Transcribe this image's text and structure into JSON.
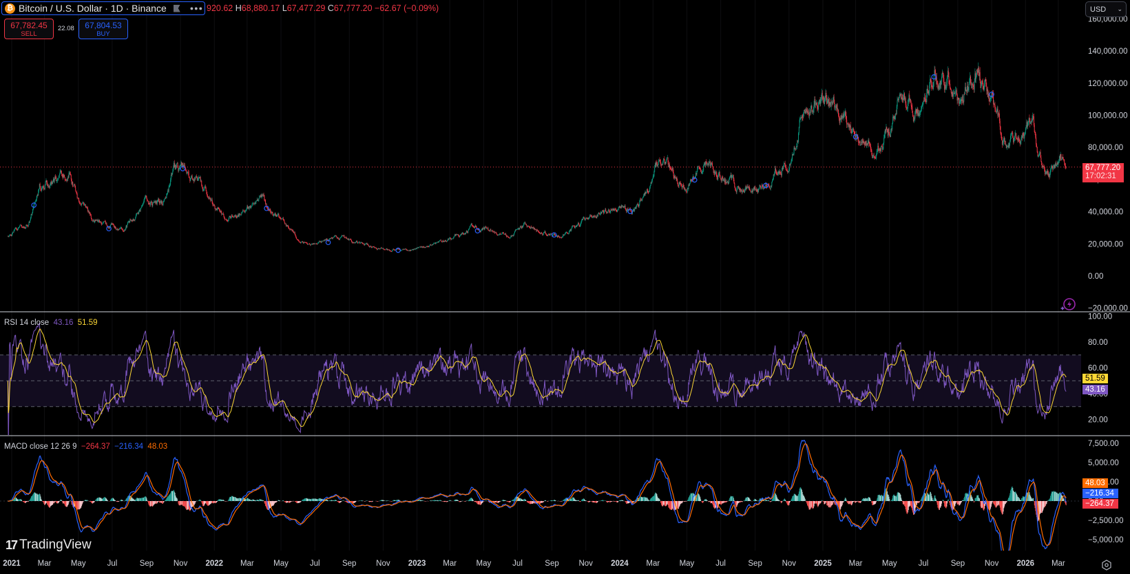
{
  "header": {
    "symbol_title": "Bitcoin / U.S. Dollar · 1D · Binance",
    "icon": "bitcoin-icon",
    "ohlc": {
      "open_partial": "920.62",
      "h_label": "H",
      "high": "68,880.17",
      "l_label": "L",
      "low": "67,477.29",
      "c_label": "C",
      "close": "67,777.20",
      "change": "−62.67 (−0.09%)"
    },
    "sell": {
      "price": "67,782.45",
      "label": "SELL"
    },
    "spread": "22.08",
    "buy": {
      "price": "67,804.53",
      "label": "BUY"
    },
    "currency": "USD"
  },
  "price_label": {
    "price": "67,777.20",
    "countdown": "17:02:31"
  },
  "rsi": {
    "title": "RSI 14 close",
    "rsi_value": "43.16",
    "ma_value": "51.59"
  },
  "macd": {
    "title": "MACD close 12 26 9",
    "hist_value": "−264.37",
    "macd_value": "−216.34",
    "signal_value": "48.03"
  },
  "logo": "TradingView",
  "colors": {
    "up": "#089981",
    "down": "#f23645",
    "rsi": "#7e57c2",
    "rsi_ma": "#fdd835",
    "macd": "#2962ff",
    "signal": "#ff6d00",
    "hist_up": "#26a69a",
    "hist_down": "#ff5252",
    "accent": "#2962ff"
  },
  "chart_data": [
    {
      "type": "candlestick",
      "title": "Bitcoin / U.S. Dollar · 1D · Binance",
      "ylim": [
        -20000,
        165000
      ],
      "y_ticks": [
        {
          "label": "160,000.00",
          "value": 160000
        },
        {
          "label": "140,000.00",
          "value": 140000
        },
        {
          "label": "120,000.00",
          "value": 120000
        },
        {
          "label": "100,000.00",
          "value": 100000
        },
        {
          "label": "80,000.00",
          "value": 80000
        },
        {
          "label": "60,000.00",
          "value": 60000
        },
        {
          "label": "40,000.00",
          "value": 40000
        },
        {
          "label": "20,000.00",
          "value": 20000
        },
        {
          "label": "0.00",
          "value": 0
        },
        {
          "label": "−20,000.00",
          "value": -20000
        }
      ],
      "x_ticks": [
        {
          "label": "2021",
          "date": "2021-01-01",
          "bold": true
        },
        {
          "label": "Mar",
          "date": "2021-03-01"
        },
        {
          "label": "May",
          "date": "2021-05-01"
        },
        {
          "label": "Jul",
          "date": "2021-07-01"
        },
        {
          "label": "Sep",
          "date": "2021-09-01"
        },
        {
          "label": "Nov",
          "date": "2021-11-01"
        },
        {
          "label": "2022",
          "date": "2022-01-01",
          "bold": true
        },
        {
          "label": "Mar",
          "date": "2022-03-01"
        },
        {
          "label": "May",
          "date": "2022-05-01"
        },
        {
          "label": "Jul",
          "date": "2022-07-01"
        },
        {
          "label": "Sep",
          "date": "2022-09-01"
        },
        {
          "label": "Nov",
          "date": "2022-11-01"
        },
        {
          "label": "2023",
          "date": "2023-01-01",
          "bold": true
        },
        {
          "label": "Mar",
          "date": "2023-03-01"
        },
        {
          "label": "May",
          "date": "2023-05-01"
        },
        {
          "label": "Jul",
          "date": "2023-07-01"
        },
        {
          "label": "Sep",
          "date": "2023-09-01"
        },
        {
          "label": "Nov",
          "date": "2023-11-01"
        },
        {
          "label": "2024",
          "date": "2024-01-01",
          "bold": true
        },
        {
          "label": "Mar",
          "date": "2024-03-01"
        },
        {
          "label": "May",
          "date": "2024-05-01"
        },
        {
          "label": "Jul",
          "date": "2024-07-01"
        },
        {
          "label": "Sep",
          "date": "2024-09-01"
        },
        {
          "label": "Nov",
          "date": "2024-11-01"
        },
        {
          "label": "2025",
          "date": "2025-01-01",
          "bold": true
        },
        {
          "label": "Mar",
          "date": "2025-03-01"
        },
        {
          "label": "May",
          "date": "2025-05-01"
        },
        {
          "label": "Jul",
          "date": "2025-07-01"
        },
        {
          "label": "Sep",
          "date": "2025-09-01"
        },
        {
          "label": "Nov",
          "date": "2025-11-01"
        },
        {
          "label": "2026",
          "date": "2026-01-01",
          "bold": true
        },
        {
          "label": "Mar",
          "date": "2026-03-01"
        }
      ],
      "last_price": 67777.2,
      "approx_close_path": [
        [
          "2020-12-25",
          24000
        ],
        [
          "2021-01-31",
          33000
        ],
        [
          "2021-02-20",
          56000
        ],
        [
          "2021-03-31",
          58800
        ],
        [
          "2021-04-14",
          63500
        ],
        [
          "2021-05-20",
          37000
        ],
        [
          "2021-06-22",
          31000
        ],
        [
          "2021-07-20",
          30000
        ],
        [
          "2021-08-31",
          47000
        ],
        [
          "2021-09-30",
          43800
        ],
        [
          "2021-10-20",
          65000
        ],
        [
          "2021-11-10",
          68000
        ],
        [
          "2021-12-31",
          46300
        ],
        [
          "2022-01-24",
          35000
        ],
        [
          "2022-03-28",
          47000
        ],
        [
          "2022-05-10",
          31000
        ],
        [
          "2022-06-18",
          19000
        ],
        [
          "2022-08-14",
          24400
        ],
        [
          "2022-09-30",
          19400
        ],
        [
          "2022-11-09",
          16000
        ],
        [
          "2022-12-31",
          16500
        ],
        [
          "2023-02-28",
          23100
        ],
        [
          "2023-04-14",
          30400
        ],
        [
          "2023-06-15",
          25000
        ],
        [
          "2023-07-13",
          31000
        ],
        [
          "2023-09-11",
          25000
        ],
        [
          "2023-10-31",
          34600
        ],
        [
          "2023-12-31",
          42300
        ],
        [
          "2024-01-23",
          39500
        ],
        [
          "2024-03-14",
          73000
        ],
        [
          "2024-05-01",
          57000
        ],
        [
          "2024-06-07",
          71000
        ],
        [
          "2024-08-05",
          54000
        ],
        [
          "2024-09-06",
          53800
        ],
        [
          "2024-10-31",
          70200
        ],
        [
          "2024-11-22",
          99000
        ],
        [
          "2024-12-17",
          106000
        ],
        [
          "2025-01-21",
          106000
        ],
        [
          "2025-02-28",
          84300
        ],
        [
          "2025-04-08",
          76300
        ],
        [
          "2025-05-22",
          111000
        ],
        [
          "2025-06-22",
          100000
        ],
        [
          "2025-07-14",
          122000
        ],
        [
          "2025-08-14",
          123000
        ],
        [
          "2025-09-01",
          108000
        ],
        [
          "2025-10-06",
          125000
        ],
        [
          "2025-10-31",
          109500
        ],
        [
          "2025-11-21",
          84000
        ],
        [
          "2025-12-31",
          87500
        ],
        [
          "2026-01-14",
          97000
        ],
        [
          "2026-02-05",
          63000
        ],
        [
          "2026-02-28",
          67000
        ],
        [
          "2026-03-05",
          72000
        ],
        [
          "2026-03-15",
          67777.2
        ]
      ],
      "event_markers": [
        "2021-02-10",
        "2021-06-25",
        "2021-11-05",
        "2022-04-05",
        "2022-07-25",
        "2022-11-28",
        "2023-04-20",
        "2023-09-05",
        "2024-01-20",
        "2024-05-15",
        "2024-09-20",
        "2025-03-01",
        "2025-07-20",
        "2025-11-01"
      ]
    },
    {
      "type": "line",
      "title": "RSI 14 close",
      "ylim": [
        0,
        100
      ],
      "bands": [
        30,
        50,
        70
      ],
      "y_ticks": [
        {
          "label": "100.00",
          "value": 100
        },
        {
          "label": "80.00",
          "value": 80
        },
        {
          "label": "60.00",
          "value": 60
        },
        {
          "label": "40.00",
          "value": 40
        },
        {
          "label": "20.00",
          "value": 20
        }
      ],
      "last": {
        "rsi": 43.16,
        "ma": 51.59
      }
    },
    {
      "type": "line+bar",
      "title": "MACD close 12 26 9",
      "y_ticks": [
        {
          "label": "7,500.00",
          "value": 7500
        },
        {
          "label": "5,000.00",
          "value": 5000
        },
        {
          "label": "2,500.00",
          "value": 2500
        },
        {
          "label": "0.00",
          "value": 0
        },
        {
          "label": "−2,500.00",
          "value": -2500
        },
        {
          "label": "−5,000.00",
          "value": -5000
        }
      ],
      "last": {
        "histogram": -264.37,
        "macd": -216.34,
        "signal": 48.03
      }
    }
  ]
}
